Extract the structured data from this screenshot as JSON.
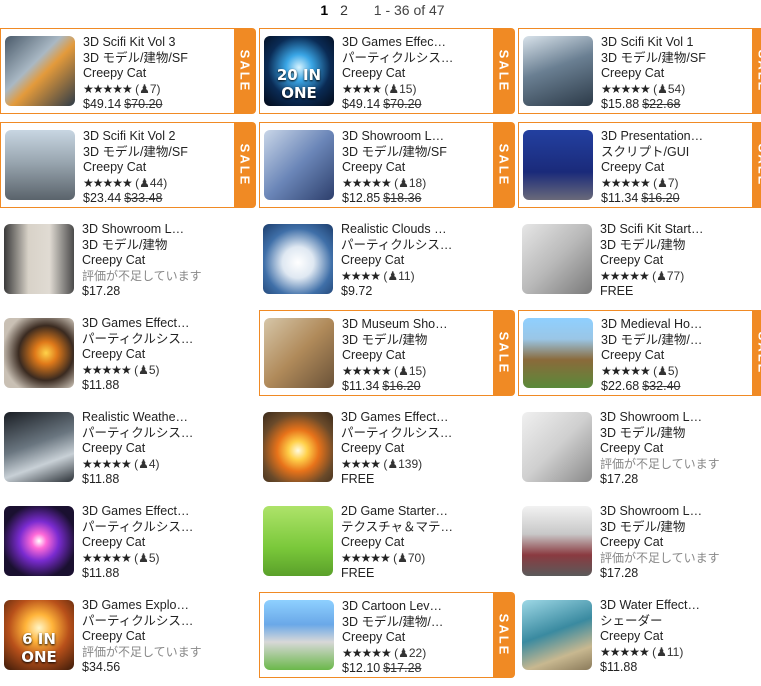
{
  "pagination": {
    "pages": [
      "1",
      "2"
    ],
    "current": "1",
    "range": "1 - 36 of 47"
  },
  "colors": {
    "sale_accent": "#f08a24"
  },
  "sale_label": "SALE",
  "no_rating_text": "評価が不足しています",
  "items": [
    {
      "title": "3D Scifi Kit Vol 3",
      "category": "3D モデル/建物/SF",
      "publisher": "Creepy Cat",
      "stars": "★★★★★",
      "reviews": "(♟7)",
      "price": "$49.14",
      "old_price": "$70.20",
      "sale": true,
      "thumb": "scifi-corridor",
      "badge": ""
    },
    {
      "title": "3D Games Effec…",
      "category": "パーティクルシス…",
      "publisher": "Creepy Cat",
      "stars": "★★★★",
      "reviews": "(♟15)",
      "price": "$49.14",
      "old_price": "$70.20",
      "sale": true,
      "thumb": "blue-portal",
      "badge": "20 IN ONE"
    },
    {
      "title": "3D Scifi Kit Vol 1",
      "category": "3D モデル/建物/SF",
      "publisher": "Creepy Cat",
      "stars": "★★★★★",
      "reviews": "(♟54)",
      "price": "$15.88",
      "old_price": "$22.68",
      "sale": true,
      "thumb": "scifi-hall",
      "badge": ""
    },
    {
      "title": "3D Scifi Kit Vol 2",
      "category": "3D モデル/建物/SF",
      "publisher": "Creepy Cat",
      "stars": "★★★★★",
      "reviews": "(♟44)",
      "price": "$23.44",
      "old_price": "$33.48",
      "sale": true,
      "thumb": "scifi-outdoor",
      "badge": ""
    },
    {
      "title": "3D Showroom L…",
      "category": "3D モデル/建物/SF",
      "publisher": "Creepy Cat",
      "stars": "★★★★★",
      "reviews": "(♟18)",
      "price": "$12.85",
      "old_price": "$18.36",
      "sale": true,
      "thumb": "logo-blue",
      "badge": ""
    },
    {
      "title": "3D Presentation…",
      "category": "スクリプト/GUI",
      "publisher": "Creepy Cat",
      "stars": "★★★★★",
      "reviews": "(♟7)",
      "price": "$11.34",
      "old_price": "$16.20",
      "sale": true,
      "thumb": "presentation",
      "badge": ""
    },
    {
      "title": "3D Showroom L…",
      "category": "3D モデル/建物",
      "publisher": "Creepy Cat",
      "stars": "",
      "reviews": "",
      "no_rating": true,
      "price": "$17.28",
      "old_price": "",
      "sale": false,
      "thumb": "showroom-lights",
      "badge": ""
    },
    {
      "title": "Realistic Clouds …",
      "category": "パーティクルシス…",
      "publisher": "Creepy Cat",
      "stars": "★★★★",
      "reviews": "(♟11)",
      "price": "$9.72",
      "old_price": "",
      "sale": false,
      "thumb": "clouds",
      "badge": ""
    },
    {
      "title": "3D Scifi Kit Start…",
      "category": "3D モデル/建物",
      "publisher": "Creepy Cat",
      "stars": "★★★★★",
      "reviews": "(♟77)",
      "price": "FREE",
      "old_price": "",
      "sale": false,
      "thumb": "starter-room",
      "badge": ""
    },
    {
      "title": "3D Games Effect…",
      "category": "パーティクルシス…",
      "publisher": "Creepy Cat",
      "stars": "★★★★★",
      "reviews": "(♟5)",
      "price": "$11.88",
      "old_price": "",
      "sale": false,
      "thumb": "effect-ring",
      "badge": ""
    },
    {
      "title": "3D Museum Sho…",
      "category": "3D モデル/建物",
      "publisher": "Creepy Cat",
      "stars": "★★★★★",
      "reviews": "(♟15)",
      "price": "$11.34",
      "old_price": "$16.20",
      "sale": true,
      "thumb": "museum",
      "badge": ""
    },
    {
      "title": "3D Medieval Ho…",
      "category": "3D モデル/建物/…",
      "publisher": "Creepy Cat",
      "stars": "★★★★★",
      "reviews": "(♟5)",
      "price": "$22.68",
      "old_price": "$32.40",
      "sale": true,
      "thumb": "medieval",
      "badge": ""
    },
    {
      "title": "Realistic Weathe…",
      "category": "パーティクルシス…",
      "publisher": "Creepy Cat",
      "stars": "★★★★★",
      "reviews": "(♟4)",
      "price": "$11.88",
      "old_price": "",
      "sale": false,
      "thumb": "weather",
      "badge": ""
    },
    {
      "title": "3D Games Effect…",
      "category": "パーティクルシス…",
      "publisher": "Creepy Cat",
      "stars": "★★★★",
      "reviews": "(♟139)",
      "price": "FREE",
      "old_price": "",
      "sale": false,
      "thumb": "explosion-small",
      "badge": ""
    },
    {
      "title": "3D Showroom L…",
      "category": "3D モデル/建物",
      "publisher": "Creepy Cat",
      "stars": "",
      "reviews": "",
      "no_rating": true,
      "price": "$17.28",
      "old_price": "",
      "sale": false,
      "thumb": "showroom-logo",
      "badge": ""
    },
    {
      "title": "3D Games Effect…",
      "category": "パーティクルシス…",
      "publisher": "Creepy Cat",
      "stars": "★★★★★",
      "reviews": "(♟5)",
      "price": "$11.88",
      "old_price": "",
      "sale": false,
      "thumb": "purple-burst",
      "badge": ""
    },
    {
      "title": "2D Game Starter…",
      "category": "テクスチャ＆マテ…",
      "publisher": "Creepy Cat",
      "stars": "★★★★★",
      "reviews": "(♟70)",
      "price": "FREE",
      "old_price": "",
      "sale": false,
      "thumb": "bird",
      "badge": ""
    },
    {
      "title": "3D Showroom L…",
      "category": "3D モデル/建物",
      "publisher": "Creepy Cat",
      "stars": "",
      "reviews": "",
      "no_rating": true,
      "price": "$17.28",
      "old_price": "",
      "sale": false,
      "thumb": "showroom-car",
      "badge": ""
    },
    {
      "title": "3D Games Explo…",
      "category": "パーティクルシス…",
      "publisher": "Creepy Cat",
      "stars": "",
      "reviews": "",
      "no_rating": true,
      "price": "$34.56",
      "old_price": "",
      "sale": false,
      "thumb": "explosion-big",
      "badge": "6 IN ONE"
    },
    {
      "title": "3D Cartoon Lev…",
      "category": "3D モデル/建物/…",
      "publisher": "Creepy Cat",
      "stars": "★★★★★",
      "reviews": "(♟22)",
      "price": "$12.10",
      "old_price": "$17.28",
      "sale": true,
      "thumb": "cartoon-city",
      "badge": ""
    },
    {
      "title": "3D Water Effect…",
      "category": "シェーダー",
      "publisher": "Creepy Cat",
      "stars": "★★★★★",
      "reviews": "(♟11)",
      "price": "$11.88",
      "old_price": "",
      "sale": false,
      "thumb": "water",
      "badge": ""
    }
  ]
}
